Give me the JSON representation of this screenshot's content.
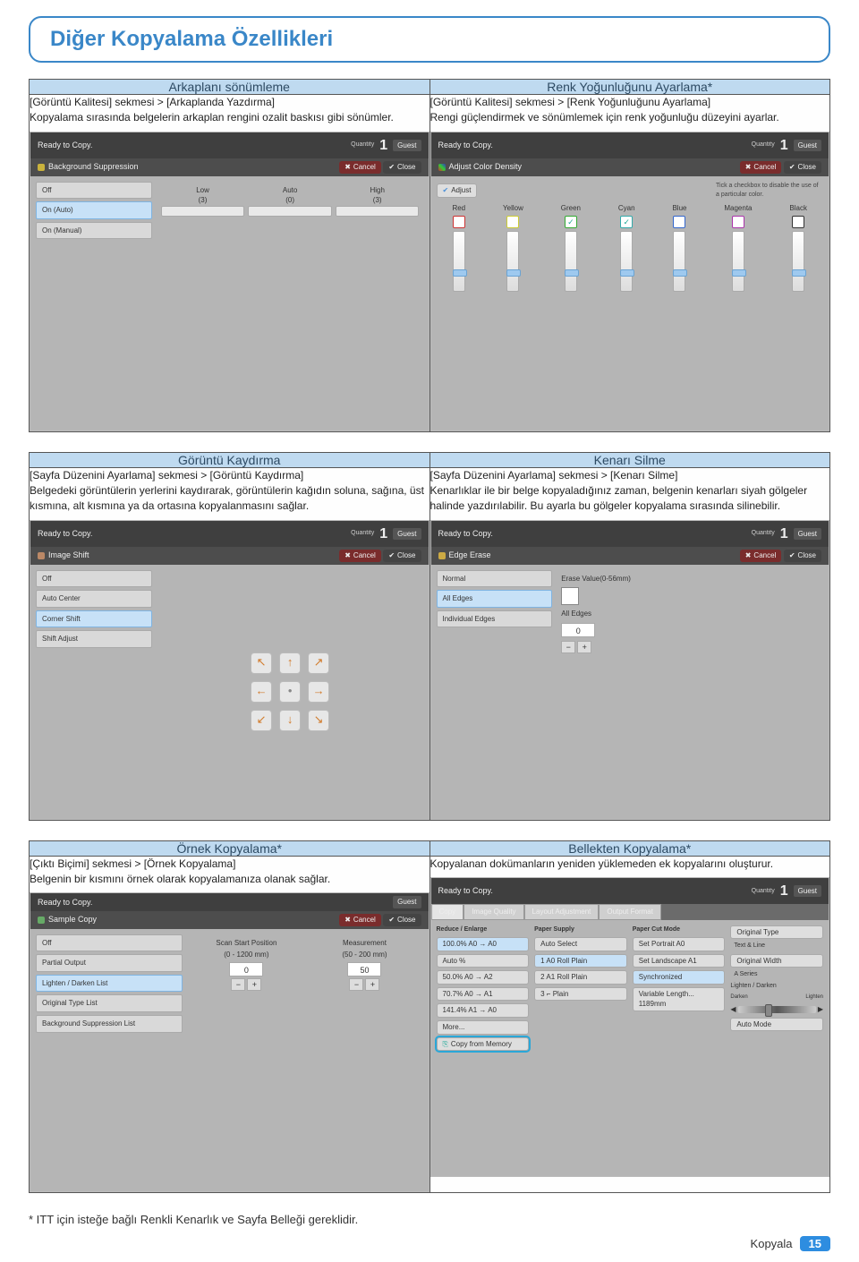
{
  "page_title": "Diğer Kopyalama Özellikleri",
  "footnote": "* ITT için isteğe bağlı Renkli Kenarlık ve Sayfa Belleği gereklidir.",
  "footer": {
    "label": "Kopyala",
    "num": "15"
  },
  "shots": {
    "common_top": {
      "ready": "Ready to Copy.",
      "quantity_label": "Quantity",
      "quantity": "1",
      "guest": "Guest"
    },
    "cancel": "Cancel",
    "close": "Close"
  },
  "row1": {
    "left": {
      "head": "Arkaplanı sönümleme",
      "body": "[Görüntü Kalitesi] sekmesi > [Arkaplanda Yazdırma]\nKopyalama sırasında belgelerin arkaplan rengini ozalit baskısı gibi sönümler.",
      "bar": "Background Suppression",
      "opts": [
        "Off",
        "On (Auto)",
        "On (Manual)"
      ],
      "cols": [
        {
          "l": "Low",
          "s": "(3)"
        },
        {
          "l": "Auto",
          "s": "(0)"
        },
        {
          "l": "High",
          "s": "(3)"
        }
      ]
    },
    "right": {
      "head": "Renk Yoğunluğunu Ayarlama*",
      "body": "[Görüntü Kalitesi] sekmesi > [Renk Yoğunluğunu Ayarlama]\nRengi güçlendirmek ve sönümlemek için renk yoğunluğu düzeyini ayarlar.",
      "bar": "Adjust Color Density",
      "adjust": "Adjust",
      "tip": "Tick a checkbox to disable the use of a particular color.",
      "colors": [
        "Red",
        "Yellow",
        "Green",
        "Cyan",
        "Blue",
        "Magenta",
        "Black"
      ]
    }
  },
  "row2": {
    "left": {
      "head": "Görüntü Kaydırma",
      "body": "[Sayfa Düzenini Ayarlama] sekmesi > [Görüntü Kaydırma]\nBelgedeki görüntülerin yerlerini kaydırarak, görüntülerin kağıdın soluna, sağına, üst kısmına, alt kısmına ya da ortasına kopyalanmasını sağlar.",
      "bar": "Image Shift",
      "opts": [
        "Off",
        "Auto Center",
        "Corner Shift",
        "Shift Adjust"
      ],
      "arrows": [
        "↖",
        "↑",
        "↗",
        "←",
        "•",
        "→",
        "↙",
        "↓",
        "↘"
      ]
    },
    "right": {
      "head": "Kenarı Silme",
      "body": "[Sayfa Düzenini Ayarlama] sekmesi > [Kenarı Silme]\nKenarlıklar ile bir belge kopyaladığınız zaman, belgenin kenarları siyah gölgeler halinde yazdırılabilir. Bu ayarla bu gölgeler kopyalama sırasında silinebilir.",
      "bar": "Edge Erase",
      "erase_label": "Erase Value(0-56mm)",
      "opts": [
        "Normal",
        "All Edges",
        "Individual Edges"
      ],
      "all_edges": "All Edges",
      "val": "0"
    }
  },
  "row3": {
    "left": {
      "head": "Örnek Kopyalama*",
      "body": "[Çıktı Biçimi] sekmesi > [Örnek Kopyalama]\nBelgenin bir kısmını örnek olarak kopyalamanıza olanak sağlar.",
      "bar": "Sample Copy",
      "opts": [
        "Off",
        "Partial Output",
        "Lighten / Darken List",
        "Original Type List",
        "Background Suppression List"
      ],
      "c1": {
        "label": "Scan Start Position",
        "range": "(0 - 1200 mm)",
        "val": "0"
      },
      "c2": {
        "label": "Measurement",
        "range": "(50 - 200 mm)",
        "val": "50"
      }
    },
    "right": {
      "head": "Bellekten Kopyalama*",
      "body": "Kopyalanan dokümanların yeniden yüklemeden ek kopyalarını oluşturur.",
      "tabs": [
        "Copy",
        "Image Quality",
        "Layout Adjustment",
        "Output Format"
      ],
      "col1": {
        "h": "Reduce / Enlarge",
        "items": [
          "100.0%  A0 → A0",
          "Auto %",
          "50.0%  A0 → A2",
          "70.7%  A0 → A1",
          "141.4%  A1 → A0",
          "More..."
        ],
        "cfm": "Copy from Memory"
      },
      "col2": {
        "h": "Paper Supply",
        "items": [
          "Auto Select",
          "1  A0 Roll Plain",
          "2  A1 Roll Plain",
          "3  ⌐ Plain"
        ]
      },
      "col3": {
        "h": "Paper Cut Mode",
        "items": [
          "Set Portrait A0",
          "Set Landscape A1",
          "Synchronized",
          "Variable Length... 1189mm"
        ]
      },
      "col4": {
        "h": "",
        "ori": {
          "l": "Original Type",
          "v": "Text & Line"
        },
        "ow": {
          "l": "Original Width",
          "v": "A Series"
        },
        "ld": {
          "l": "Lighten / Darken",
          "d": "Darken",
          "g": "Lighten"
        },
        "am": "Auto Mode"
      }
    }
  }
}
